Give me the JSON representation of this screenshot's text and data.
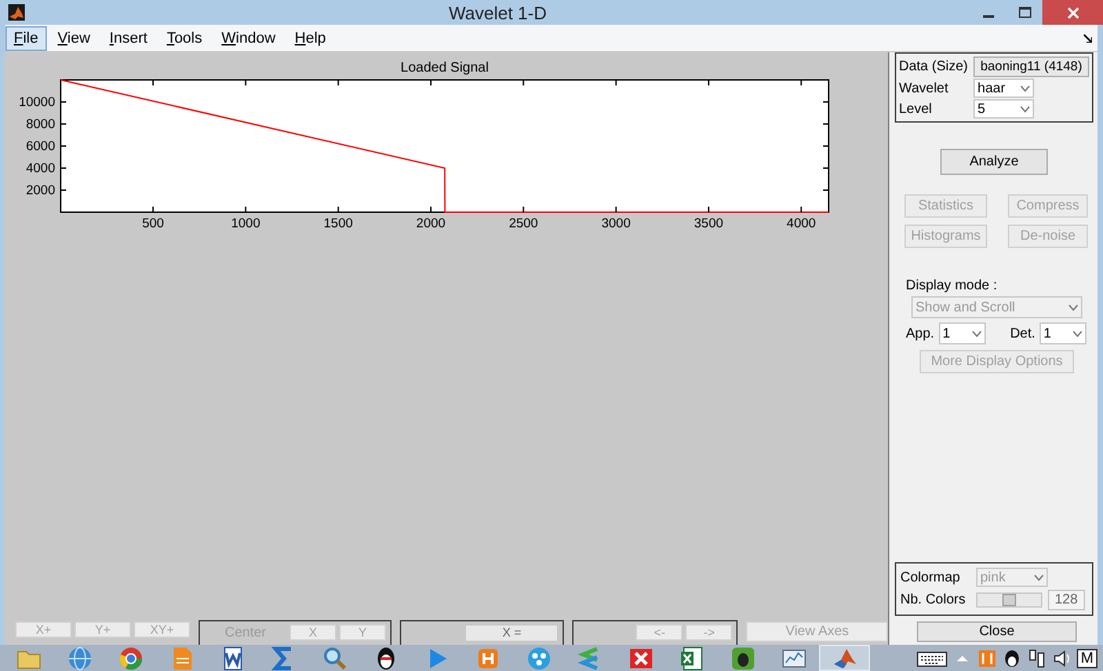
{
  "window": {
    "title": "Wavelet 1-D"
  },
  "menu": [
    {
      "label": "File",
      "selected": true
    },
    {
      "label": "View",
      "selected": false
    },
    {
      "label": "Insert",
      "selected": false
    },
    {
      "label": "Tools",
      "selected": false
    },
    {
      "label": "Window",
      "selected": false
    },
    {
      "label": "Help",
      "selected": false
    }
  ],
  "chart": {
    "chart_data": {
      "type": "line",
      "title": "Loaded Signal",
      "x": [
        1,
        2075,
        2076,
        4148
      ],
      "series": [
        {
          "color": "#ff0000",
          "values": [
            12000,
            4000,
            0,
            0
          ]
        }
      ],
      "xlim": [
        1,
        4148
      ],
      "ylim": [
        0,
        12000
      ],
      "xticks": [
        500,
        1000,
        1500,
        2000,
        2500,
        3000,
        3500,
        4000
      ],
      "yticks": [
        2000,
        4000,
        6000,
        8000,
        10000
      ]
    }
  },
  "panel": {
    "data_label": "Data (Size)",
    "data_value": "baoning11 (4148)",
    "wavelet_label": "Wavelet",
    "wavelet": "haar",
    "level_label": "Level",
    "level_value": "5"
  },
  "analyze": {
    "label": "Analyze",
    "disabled": false
  },
  "tool_buttons": [
    {
      "label": "Statistics",
      "disabled": true
    },
    {
      "label": "Compress",
      "disabled": true
    },
    {
      "label": "Histograms",
      "disabled": true
    },
    {
      "label": "De-noise",
      "disabled": true
    }
  ],
  "display": {
    "label": "Display mode :",
    "mode": "Show and Scroll",
    "mode_disabled": true,
    "app_label": "App.",
    "app": "1",
    "det_label": "Det.",
    "det": "1",
    "more": {
      "label": "More Display Options",
      "disabled": true
    }
  },
  "colormap": {
    "label": "Colormap",
    "value": "pink",
    "disabled": true,
    "colors_label": "Nb. Colors",
    "colors_slider": {
      "level": 0.5
    },
    "colors_value": "128"
  },
  "close": {
    "label": "Close",
    "disabled": false
  },
  "bottom_toolbar": {
    "zoom_buttons": [
      {
        "label": "X+",
        "disabled": true
      },
      {
        "label": "Y+",
        "disabled": true
      },
      {
        "label": "XY+",
        "disabled": true
      }
    ],
    "center": {
      "label": "Center",
      "buttons": [
        {
          "label": "X",
          "disabled": true
        },
        {
          "label": "Y",
          "disabled": true
        }
      ]
    },
    "info": {
      "field": "X ="
    },
    "history": {
      "buttons": [
        {
          "label": "<-",
          "disabled": true
        },
        {
          "label": "->",
          "disabled": true
        }
      ]
    },
    "view_axes": {
      "label": "View Axes",
      "disabled": true
    }
  },
  "taskbar": {
    "apps": [
      {
        "kind": "folder",
        "selected": false
      },
      {
        "kind": "globe",
        "selected": false
      },
      {
        "kind": "browser",
        "selected": false
      },
      {
        "kind": "document",
        "selected": false
      },
      {
        "kind": "word",
        "selected": false
      },
      {
        "kind": "sigma",
        "selected": false
      },
      {
        "kind": "magnifier",
        "selected": false
      },
      {
        "kind": "penguin",
        "selected": false
      },
      {
        "kind": "play",
        "selected": false
      },
      {
        "kind": "tile",
        "selected": false
      },
      {
        "kind": "share",
        "selected": false
      },
      {
        "kind": "chevrons",
        "selected": false
      },
      {
        "kind": "cross",
        "selected": false
      },
      {
        "kind": "sheet",
        "selected": false
      },
      {
        "kind": "elephant",
        "selected": false
      },
      {
        "kind": "chart",
        "selected": false
      },
      {
        "kind": "peak",
        "selected": true
      }
    ],
    "tray": [
      {
        "kind": "keyboard"
      },
      {
        "kind": "caret"
      },
      {
        "kind": "tile"
      },
      {
        "kind": "penguin"
      },
      {
        "kind": "network"
      },
      {
        "kind": "speaker"
      },
      {
        "kind": "ime",
        "label": "M"
      }
    ]
  }
}
